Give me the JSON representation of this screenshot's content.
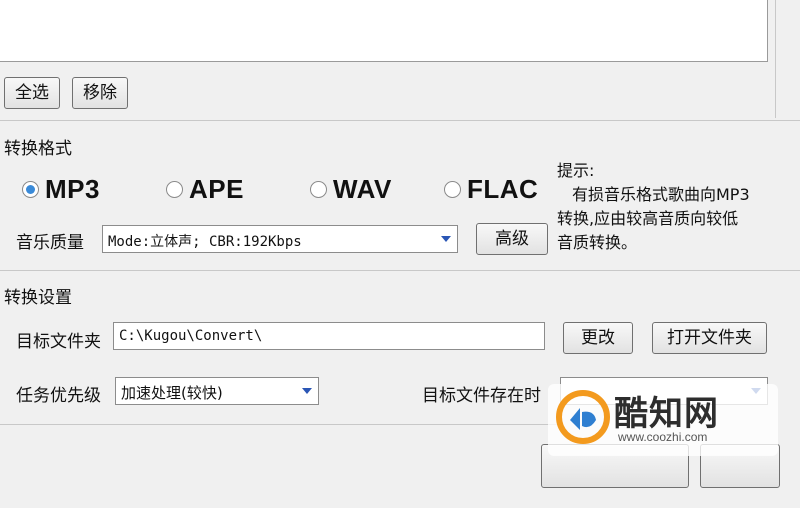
{
  "file_list": {
    "items": []
  },
  "list_buttons": {
    "select_all": "全选",
    "remove": "移除"
  },
  "format_section": {
    "title": "转换格式",
    "options": [
      {
        "label": "MP3",
        "selected": true
      },
      {
        "label": "APE",
        "selected": false
      },
      {
        "label": "WAV",
        "selected": false
      },
      {
        "label": "FLAC",
        "selected": false
      }
    ],
    "quality_label": "音乐质量",
    "quality_value": "Mode:立体声; CBR:192Kbps",
    "advanced_button": "高级",
    "hint_title": "提示:",
    "hint_line1": "有损音乐格式歌曲向MP3",
    "hint_line2": "转换,应由较高音质向较低",
    "hint_line3": "音质转换。"
  },
  "settings_section": {
    "title": "转换设置",
    "target_folder_label": "目标文件夹",
    "target_folder_value": "C:\\Kugou\\Convert\\",
    "change_button": "更改",
    "open_folder_button": "打开文件夹",
    "priority_label": "任务优先级",
    "priority_value": "加速处理(较快)",
    "exists_label": "目标文件存在时"
  },
  "watermark": {
    "title": "酷知网",
    "url": "www.coozhi.com"
  },
  "colors": {
    "window_bg": "#f0f0f0",
    "radio_selected": "#3a8ad8",
    "combo_arrow": "#2a56b5"
  }
}
